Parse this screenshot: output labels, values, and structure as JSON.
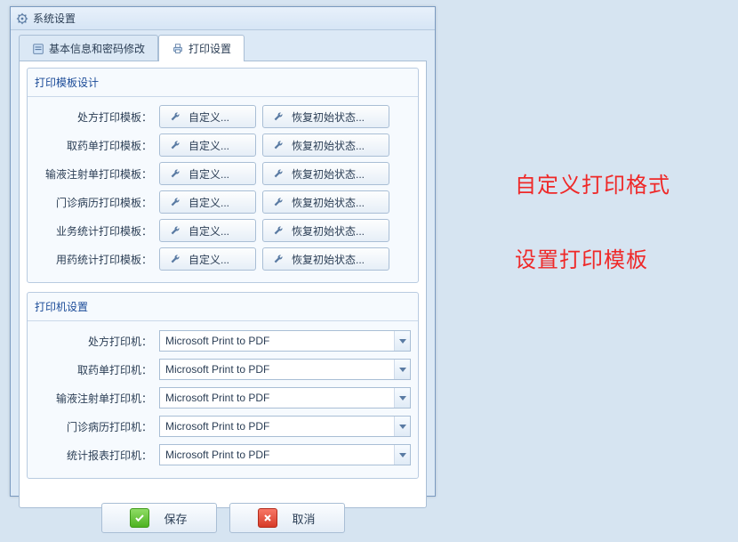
{
  "window": {
    "title": "系统设置"
  },
  "tabs": [
    {
      "label": "基本信息和密码修改",
      "active": false
    },
    {
      "label": "打印设置",
      "active": true
    }
  ],
  "template_group": {
    "title": "打印模板设计",
    "customize": "自定义...",
    "restore": "恢复初始状态...",
    "rows": [
      {
        "label": "处方打印模板："
      },
      {
        "label": "取药单打印模板："
      },
      {
        "label": "输液注射单打印模板："
      },
      {
        "label": "门诊病历打印模板："
      },
      {
        "label": "业务统计打印模板："
      },
      {
        "label": "用药统计打印模板："
      }
    ]
  },
  "printer_group": {
    "title": "打印机设置",
    "rows": [
      {
        "label": "处方打印机：",
        "value": "Microsoft Print to PDF"
      },
      {
        "label": "取药单打印机：",
        "value": "Microsoft Print to PDF"
      },
      {
        "label": "输液注射单打印机：",
        "value": "Microsoft Print to PDF"
      },
      {
        "label": "门诊病历打印机：",
        "value": "Microsoft Print to PDF"
      },
      {
        "label": "统计报表打印机：",
        "value": "Microsoft Print to PDF"
      }
    ]
  },
  "footer": {
    "save": "保存",
    "cancel": "取消"
  },
  "annotations": {
    "line1": "自定义打印格式",
    "line2": "设置打印模板"
  }
}
